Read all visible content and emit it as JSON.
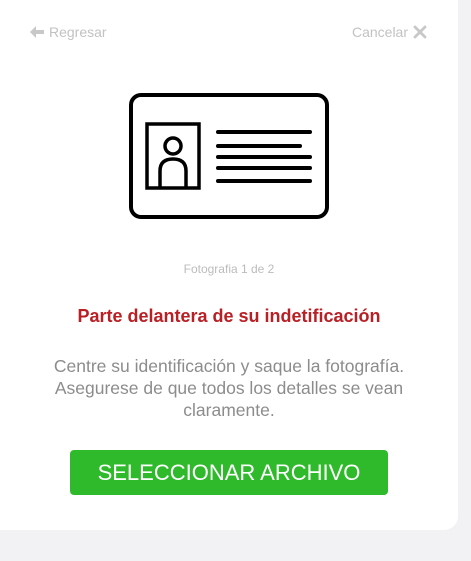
{
  "nav": {
    "back_label": "Regresar",
    "cancel_label": "Cancelar",
    "back_icon": "arrow-left-icon",
    "cancel_icon": "close-icon"
  },
  "illustration": {
    "icon": "id-card-icon"
  },
  "photo_counter": "Fotografia 1 de 2",
  "title": "Parte delantera de su indetificación",
  "instructions": "Centre su identificación y saque la fotografía. Asegurese de que todos los detalles se vean claramente.",
  "select_button_label": "SELECCIONAR ARCHIVO",
  "colors": {
    "accent_red": "#b82025",
    "button_green": "#2fba2c",
    "muted_text": "#8c8c8c",
    "nav_text": "#c2c2c2"
  }
}
